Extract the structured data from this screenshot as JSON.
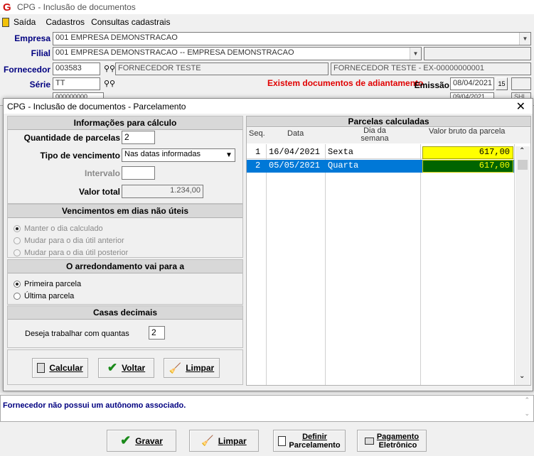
{
  "app": {
    "title": "CPG - Inclusão de documentos",
    "logo_letter": "G"
  },
  "menu": {
    "items": [
      "Saída",
      "Cadastros",
      "Consultas cadastrais"
    ]
  },
  "form": {
    "empresa_label": "Empresa",
    "empresa_value": "001 EMPRESA DEMONSTRACAO",
    "filial_label": "Filial",
    "filial_value": "001 EMPRESA DEMONSTRACAO -- EMPRESA DEMONSTRACAO",
    "fornecedor_label": "Fornecedor",
    "fornecedor_code": "003583",
    "fornecedor_name": "FORNECEDOR TESTE",
    "fornecedor_full": "FORNECEDOR TESTE - EX-00000000001",
    "serie_label": "Série",
    "serie_value": "TT",
    "adiantamento_warning": "Existem documentos de adiantamento",
    "emissao_label": "Emissão",
    "emissao_value": "08/04/2021",
    "doc_partial": "000000000",
    "date_partial": "09/04/2021",
    "side_partial": "SHL"
  },
  "dialog": {
    "title": "CPG - Inclusão de documentos - Parcelamento",
    "info_header": "Informações para cálculo",
    "qtd_label": "Quantidade de parcelas",
    "qtd_value": "2",
    "tipo_label": "Tipo de vencimento",
    "tipo_value": "Nas datas informadas",
    "intervalo_label": "Intervalo",
    "intervalo_value": "",
    "valor_label": "Valor total",
    "valor_value": "1.234,00",
    "venc_header": "Vencimentos em dias não úteis",
    "venc_options": [
      "Manter o dia calculado",
      "Mudar para o dia útil anterior",
      "Mudar para o dia útil posterior"
    ],
    "arred_header": "O arredondamento vai para a",
    "arred_options": [
      "Primeira parcela",
      "Última parcela"
    ],
    "casas_header": "Casas decimais",
    "casas_label": "Deseja trabalhar com quantas",
    "casas_value": "2",
    "btn_calcular": "Calcular",
    "btn_voltar": "Voltar",
    "btn_limpar": "Limpar",
    "grid_header": "Parcelas calculadas",
    "col_seq": "Seq.",
    "col_data": "Data",
    "col_dia": "Dia da semana",
    "col_valor": "Valor bruto da parcela",
    "rows": [
      {
        "seq": "1",
        "data": "16/04/2021",
        "dia": "Sexta",
        "valor": "617,00"
      },
      {
        "seq": "2",
        "data": "05/05/2021",
        "dia": "Quarta",
        "valor": "617,00"
      }
    ]
  },
  "status": {
    "message": "Fornecedor não possui um autônomo associado."
  },
  "footer": {
    "gravar": "Gravar",
    "limpar": "Limpar",
    "definir_1": "Definir",
    "definir_2": "Parcelamento",
    "pagamento_1": "Pagamento",
    "pagamento_2": "Eletrônico"
  },
  "colors": {
    "accent": "#000080",
    "warning": "#e00000",
    "highlight_yellow": "#ffff00",
    "selection": "#0078d7",
    "highlight_green": "#006400"
  }
}
